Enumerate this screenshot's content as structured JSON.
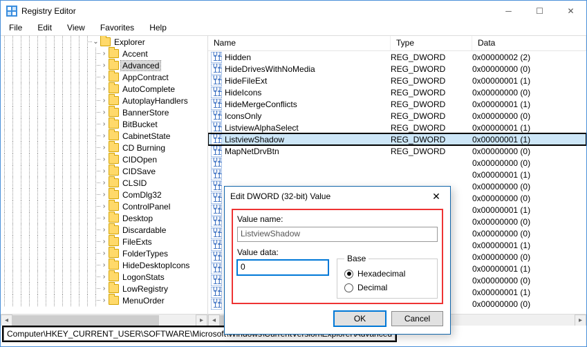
{
  "window": {
    "title": "Registry Editor",
    "menu": {
      "file": "File",
      "edit": "Edit",
      "view": "View",
      "favorites": "Favorites",
      "help": "Help"
    }
  },
  "tree": {
    "parent": "Explorer",
    "items": [
      "Accent",
      "Advanced",
      "AppContract",
      "AutoComplete",
      "AutoplayHandlers",
      "BannerStore",
      "BitBucket",
      "CabinetState",
      "CD Burning",
      "CIDOpen",
      "CIDSave",
      "CLSID",
      "ComDlg32",
      "ControlPanel",
      "Desktop",
      "Discardable",
      "FileExts",
      "FolderTypes",
      "HideDesktopIcons",
      "LogonStats",
      "LowRegistry",
      "MenuOrder"
    ],
    "selected": "Advanced"
  },
  "columns": {
    "name": "Name",
    "type": "Type",
    "data": "Data"
  },
  "values": [
    {
      "name": "Hidden",
      "type": "REG_DWORD",
      "data": "0x00000002 (2)"
    },
    {
      "name": "HideDrivesWithNoMedia",
      "type": "REG_DWORD",
      "data": "0x00000000 (0)"
    },
    {
      "name": "HideFileExt",
      "type": "REG_DWORD",
      "data": "0x00000001 (1)"
    },
    {
      "name": "HideIcons",
      "type": "REG_DWORD",
      "data": "0x00000000 (0)"
    },
    {
      "name": "HideMergeConflicts",
      "type": "REG_DWORD",
      "data": "0x00000001 (1)"
    },
    {
      "name": "IconsOnly",
      "type": "REG_DWORD",
      "data": "0x00000000 (0)"
    },
    {
      "name": "ListviewAlphaSelect",
      "type": "REG_DWORD",
      "data": "0x00000001 (1)"
    },
    {
      "name": "ListviewShadow",
      "type": "REG_DWORD",
      "data": "0x00000001 (1)"
    },
    {
      "name": "MapNetDrvBtn",
      "type": "REG_DWORD",
      "data": "0x00000000 (0)"
    },
    {
      "name": "",
      "type": "",
      "data": "0x00000000 (0)"
    },
    {
      "name": "",
      "type": "",
      "data": "0x00000001 (1)"
    },
    {
      "name": "",
      "type": "",
      "data": "0x00000000 (0)"
    },
    {
      "name": "",
      "type": "",
      "data": "0x00000000 (0)"
    },
    {
      "name": "",
      "type": "",
      "data": "0x00000001 (1)"
    },
    {
      "name": "",
      "type": "",
      "data": "0x00000000 (0)"
    },
    {
      "name": "",
      "type": "",
      "data": "0x00000000 (0)"
    },
    {
      "name": "",
      "type": "",
      "data": "0x00000001 (1)"
    },
    {
      "name": "",
      "type": "",
      "data": "0x00000000 (0)"
    },
    {
      "name": "",
      "type": "",
      "data": "0x00000001 (1)"
    },
    {
      "name": "",
      "type": "",
      "data": "0x00000000 (0)"
    },
    {
      "name": "",
      "type": "",
      "data": "0x00000001 (1)"
    },
    {
      "name": "",
      "type": "",
      "data": "0x00000000 (0)"
    }
  ],
  "selected_value_index": 7,
  "dialog": {
    "title": "Edit DWORD (32-bit) Value",
    "value_name_label": "Value name:",
    "value_name": "ListviewShadow",
    "value_data_label": "Value data:",
    "value_data": "0",
    "base_label": "Base",
    "hex": "Hexadecimal",
    "dec": "Decimal",
    "base_selected": "hex",
    "ok": "OK",
    "cancel": "Cancel"
  },
  "statusbar": {
    "path": "Computer\\HKEY_CURRENT_USER\\SOFTWARE\\Microsoft\\Windows\\CurrentVersion\\Explorer\\Advanced"
  }
}
